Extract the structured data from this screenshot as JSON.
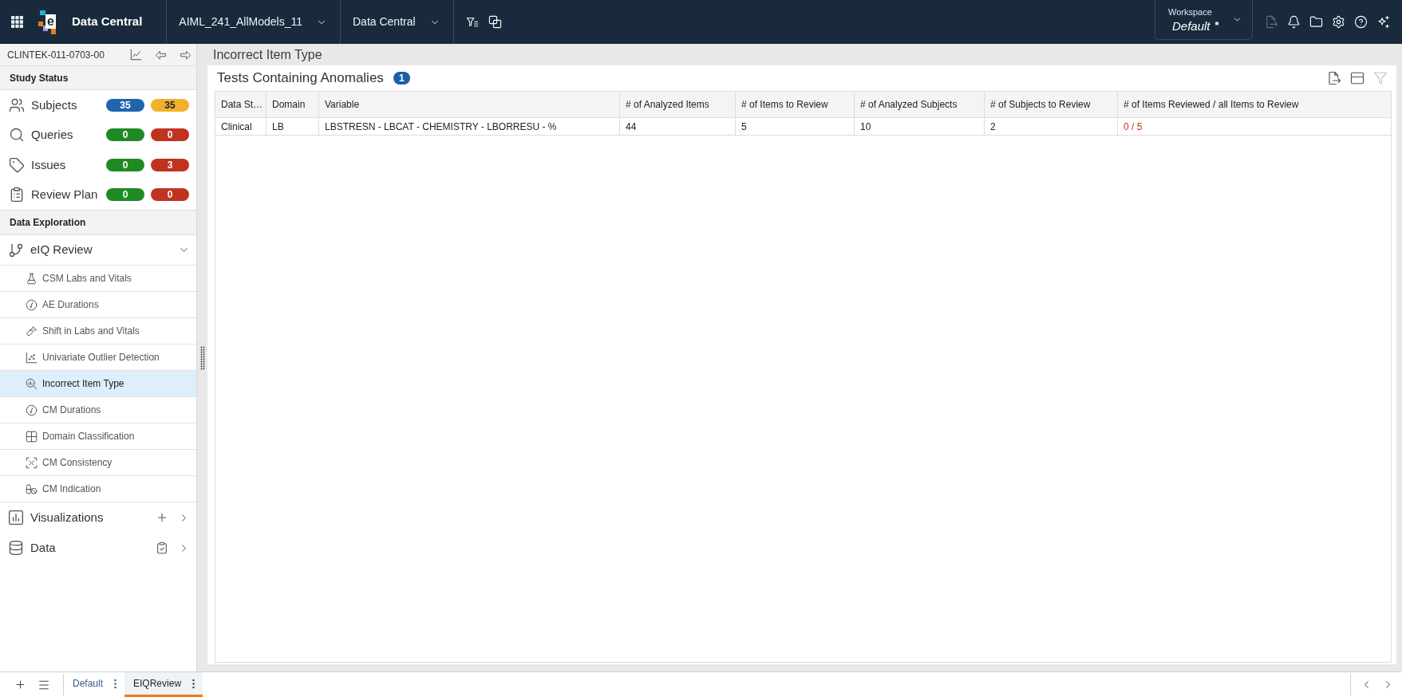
{
  "app_bar": {
    "logo_mark": "e",
    "product": "Data Central",
    "study_selector": "AIML_241_AllModels_11",
    "module_selector": "Data Central",
    "workspace": {
      "label": "Workspace",
      "value": "Default",
      "modified_mark": "*"
    },
    "actions": [
      {
        "kind": "export",
        "disabled": true
      },
      {
        "kind": "notifications",
        "disabled": false
      },
      {
        "kind": "folder",
        "disabled": false
      },
      {
        "kind": "settings",
        "disabled": false
      },
      {
        "kind": "help",
        "disabled": false
      },
      {
        "kind": "assistant",
        "disabled": false
      }
    ]
  },
  "sidebar": {
    "study_id": "CLINTEK-011-0703-00",
    "study_status": {
      "title": "Study Status",
      "items": [
        {
          "label": "Subjects",
          "counts": [
            {
              "value": "35",
              "color": "#1f65ad"
            },
            {
              "value": "35",
              "color": "#f2b12d"
            }
          ]
        },
        {
          "label": "Queries",
          "counts": [
            {
              "value": "0",
              "color": "#1e8a23"
            },
            {
              "value": "0",
              "color": "#c1331f"
            }
          ]
        },
        {
          "label": "Issues",
          "counts": [
            {
              "value": "0",
              "color": "#1e8a23"
            },
            {
              "value": "3",
              "color": "#c1331f"
            }
          ]
        },
        {
          "label": "Review Plan",
          "counts": [
            {
              "value": "0",
              "color": "#1e8a23"
            },
            {
              "value": "0",
              "color": "#c1331f"
            }
          ]
        }
      ]
    },
    "data_exploration": {
      "title": "Data Exploration",
      "groups": [
        {
          "label": "eIQ Review",
          "expanded": true,
          "children": [
            {
              "label": "CSM Labs and Vitals",
              "selected": false
            },
            {
              "label": "AE Durations",
              "selected": false
            },
            {
              "label": "Shift in Labs and Vitals",
              "selected": false
            },
            {
              "label": "Univariate Outlier Detection",
              "selected": false
            },
            {
              "label": "Incorrect Item Type",
              "selected": true
            },
            {
              "label": "CM Durations",
              "selected": false
            },
            {
              "label": "Domain Classification",
              "selected": false
            },
            {
              "label": "CM Consistency",
              "selected": false
            },
            {
              "label": "CM Indication",
              "selected": false
            }
          ]
        },
        {
          "label": "Visualizations",
          "expanded": false
        },
        {
          "label": "Data",
          "expanded": false
        }
      ]
    }
  },
  "page": {
    "title": "Incorrect Item Type",
    "card": {
      "title": "Tests Containing Anomalies",
      "count": "1",
      "tools": [
        {
          "kind": "export",
          "disabled": false
        },
        {
          "kind": "layout",
          "disabled": false
        },
        {
          "kind": "filter",
          "disabled": true
        }
      ],
      "table": {
        "columns": [
          "Data St…",
          "Domain",
          "Variable",
          "# of Analyzed Items",
          "# of Items to Review",
          "# of Analyzed Subjects",
          "# of Subjects to Review",
          "# of Items Reviewed / all Items to Review"
        ],
        "rows": [
          {
            "cells": [
              "Clinical",
              "LB",
              "LBSTRESN - LBCAT - CHEMISTRY - LBORRESU - %",
              "44",
              "5",
              "10",
              "2",
              "0 / 5"
            ],
            "review_complete": false
          }
        ]
      }
    }
  },
  "bottom_tabs": [
    {
      "label": "Default",
      "selected": false
    },
    {
      "label": "EIQReview",
      "selected": true
    }
  ]
}
